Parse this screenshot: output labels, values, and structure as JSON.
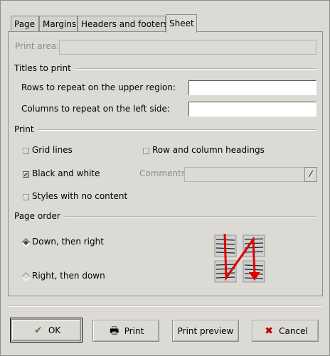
{
  "tabs": [
    {
      "label": "Page"
    },
    {
      "label": "Margins"
    },
    {
      "label": "Headers and footers"
    },
    {
      "label": "Sheet"
    }
  ],
  "print_area": {
    "label": "Print area:",
    "value": ""
  },
  "titles_section": {
    "title": "Titles to print",
    "rows_label": "Rows to repeat on the upper region:",
    "rows_value": "",
    "cols_label": "Columns to repeat on the left side:",
    "cols_value": ""
  },
  "print_section": {
    "title": "Print",
    "grid_lines": {
      "label": "Grid lines",
      "checked": false
    },
    "row_col_headings": {
      "label": "Row and column headings",
      "checked": false
    },
    "black_white": {
      "label": "Black and white",
      "checked": true
    },
    "comments": {
      "label": "Comments",
      "value": ""
    },
    "styles_no_content": {
      "label": "Styles with no content",
      "checked": false
    }
  },
  "page_order": {
    "title": "Page order",
    "down_then_right": {
      "label": "Down, then right",
      "selected": true
    },
    "right_then_down": {
      "label": "Right, then down",
      "selected": false
    }
  },
  "buttons": {
    "ok": "OK",
    "print": "Print",
    "print_preview": "Print preview",
    "cancel": "Cancel"
  },
  "colors": {
    "accent_arrow": "#e00000",
    "ok_icon": "#4a8a2a",
    "cancel_icon": "#c00000"
  }
}
